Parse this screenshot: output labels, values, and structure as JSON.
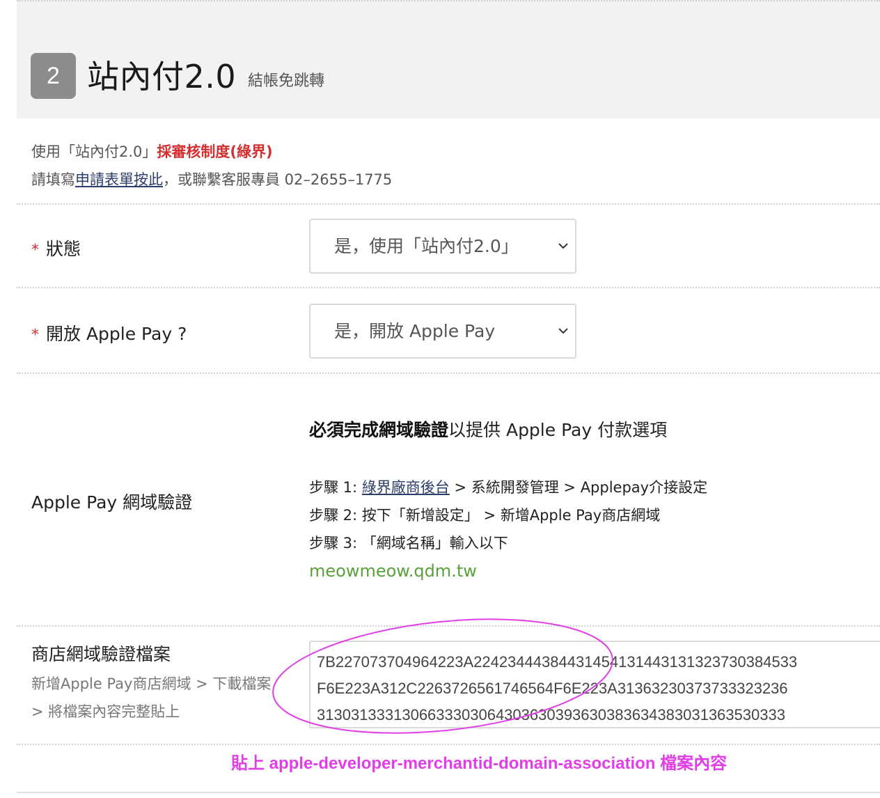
{
  "header": {
    "step_number": "2",
    "title": "站內付2.0",
    "subtitle": "結帳免跳轉"
  },
  "intro": {
    "line1_prefix": "使用「站內付2.0」",
    "line1_highlight": "採審核制度(綠界)",
    "line2_prefix": "請填寫",
    "line2_link": "申請表單按此",
    "line2_suffix": "，或聯繫客服專員 02–2655–1775"
  },
  "status_field": {
    "required_mark": "*",
    "label": "狀態",
    "selected_value": "是，使用「站內付2.0」"
  },
  "applepay_field": {
    "required_mark": "*",
    "label": "開放 Apple Pay ?",
    "selected_value": "是，開放 Apple Pay"
  },
  "domain_verify": {
    "label": "Apple Pay 網域驗證",
    "heading_bold": "必須完成網域驗證",
    "heading_rest": "以提供 Apple Pay 付款選項",
    "step1_prefix": "步驟 1: ",
    "step1_link": "綠界廠商後台",
    "step1_suffix": " > 系統開發管理 > Applepay介接設定",
    "step2": "步驟 2: 按下「新增設定」 > 新增Apple Pay商店網域",
    "step3": "步驟 3: 「網域名稱」輸入以下",
    "domain": "meowmeow.qdm.tw"
  },
  "store_file": {
    "label": "商店網域驗證檔案",
    "description": "新增Apple Pay商店網域 > 下載檔案 > 將檔案內容完整貼上",
    "content_line1": "7B227073704964223A22423444384431454131443131323730384533",
    "content_line2": "F6E223A312C2263726561746564F6E223A31363230373733323236",
    "content_line3": "3130313331306633303064303630393630383634383031363530333"
  },
  "annotation": {
    "text": "貼上 apple-developer-merchantid-domain-association 檔案內容",
    "color": "#e23ee8"
  },
  "colors": {
    "required": "#d32f2f",
    "link": "#2b3d6b",
    "domain": "#5aa03c"
  }
}
